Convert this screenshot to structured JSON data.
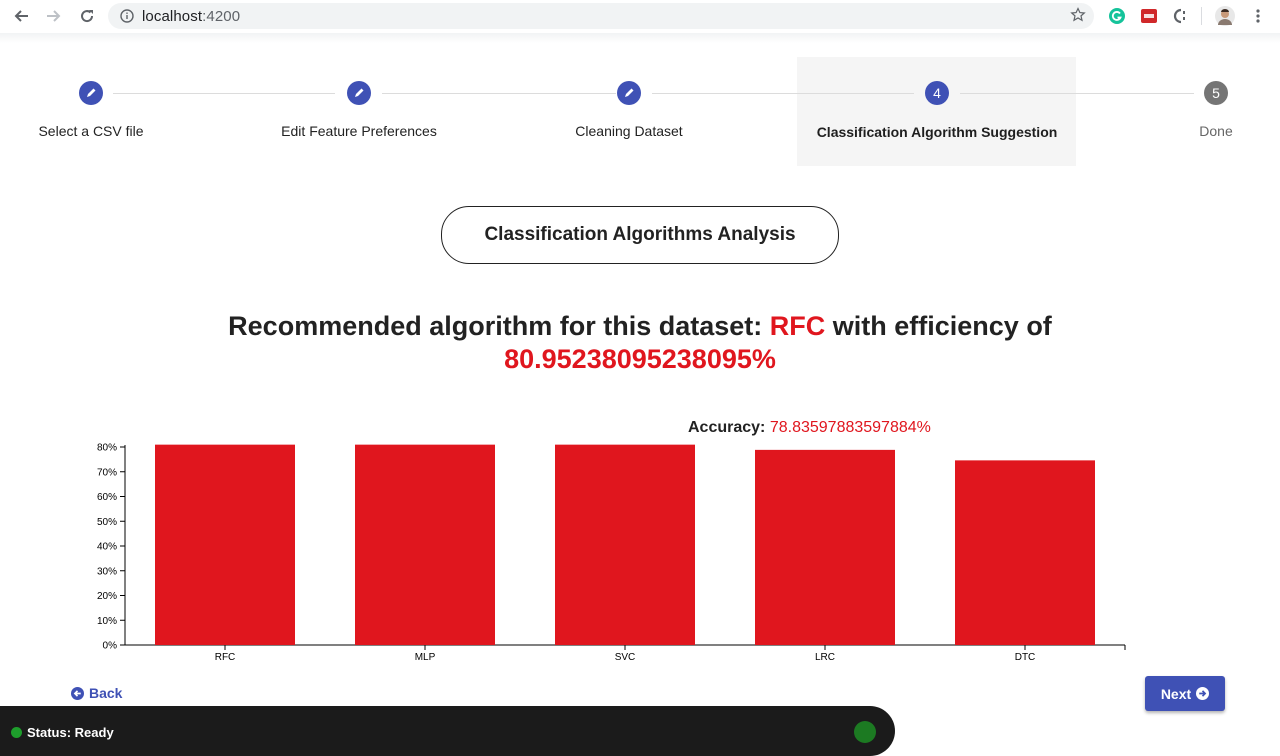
{
  "browser": {
    "url_host": "localhost",
    "url_port": ":4200"
  },
  "stepper": {
    "steps": [
      {
        "label": "Select a CSV file",
        "state": "done"
      },
      {
        "label": "Edit Feature Preferences",
        "state": "done"
      },
      {
        "label": "Cleaning Dataset",
        "state": "done"
      },
      {
        "label": "Classification Algorithm Suggestion",
        "state": "current",
        "number": "4"
      },
      {
        "label": "Done",
        "state": "todo",
        "number": "5"
      }
    ]
  },
  "heading": "Classification Algorithms Analysis",
  "recommendation": {
    "prefix": "Recommended algorithm for this dataset: ",
    "algorithm": "RFC",
    "middle": " with efficiency of",
    "efficiency": "80.95238095238095%"
  },
  "tooltip": {
    "label": "Accuracy: ",
    "value": "78.83597883597884%"
  },
  "chart_data": {
    "type": "bar",
    "categories": [
      "RFC",
      "MLP",
      "SVC",
      "LRC",
      "DTC"
    ],
    "values": [
      80.95,
      80.95,
      80.95,
      78.84,
      74.6
    ],
    "ylim": [
      0,
      80
    ],
    "yticks": [
      "0%",
      "10%",
      "20%",
      "30%",
      "40%",
      "50%",
      "60%",
      "70%",
      "80%"
    ],
    "bar_color": "#e0161e",
    "grid": false
  },
  "buttons": {
    "back": "Back",
    "next": "Next"
  },
  "status": {
    "text": "Status: Ready",
    "indicator_color": "#1e9e2c"
  }
}
